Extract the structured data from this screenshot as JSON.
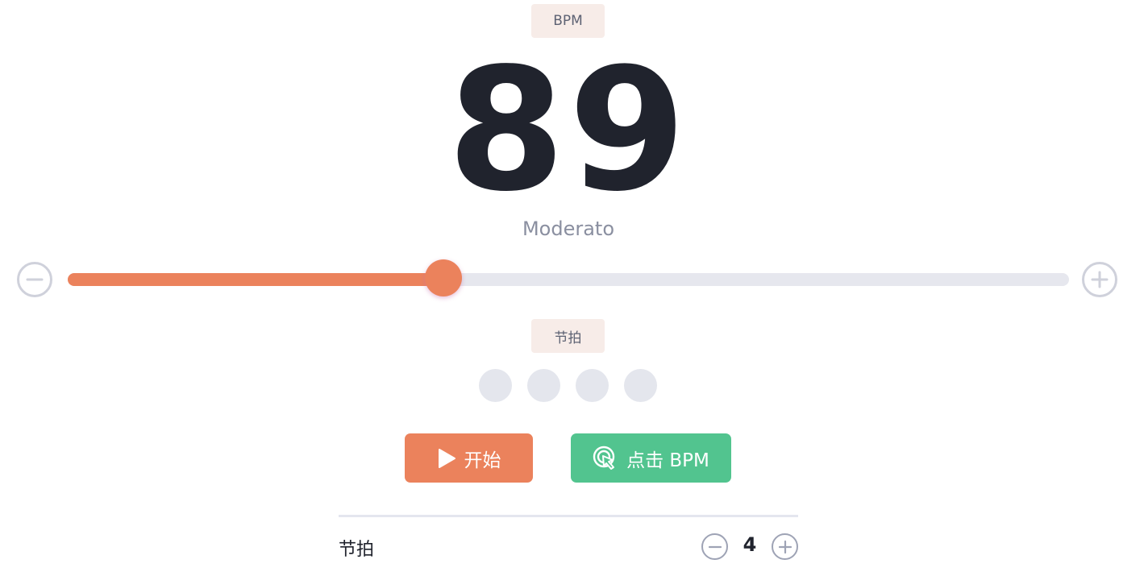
{
  "bpm_label": "BPM",
  "bpm_value": "89",
  "tempo_name": "Moderato",
  "slider": {
    "value_bpm": 89,
    "fill_fraction": 0.375
  },
  "beats_label": "节拍",
  "beat_indicators": 4,
  "buttons": {
    "start_label": "开始",
    "tap_label": "点击 BPM"
  },
  "settings": {
    "beats_label": "节拍",
    "beats_value": "4"
  },
  "icons": {
    "decrease": "minus-circle-icon",
    "increase": "plus-circle-icon",
    "play": "play-icon",
    "tap": "tap-pointer-icon"
  },
  "colors": {
    "accent": "#eb825c",
    "tap": "#52c48f",
    "text": "#20232d",
    "muted": "#8a8fa0",
    "pill_bg": "#f7ece8",
    "track": "#e6e7ee"
  }
}
